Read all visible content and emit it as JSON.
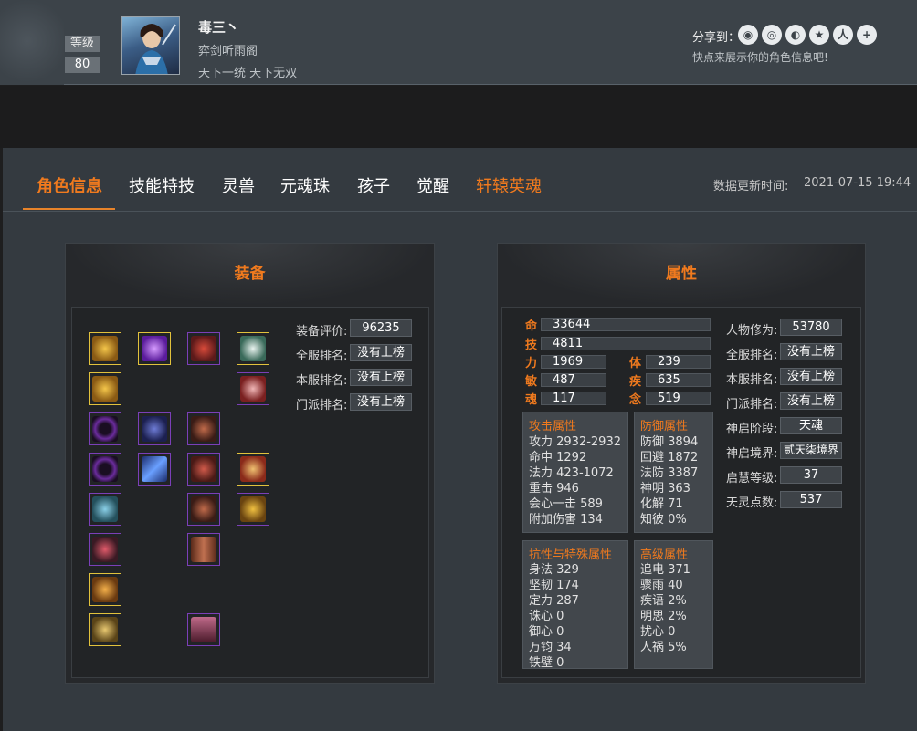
{
  "header": {
    "level_label": "等级",
    "level_value": "80",
    "player_name": "毒三丶",
    "guild": "弈剑听雨阁",
    "motto": "天下一统 天下无双",
    "share_label": "分享到：",
    "share_icons": [
      "wechat-icon",
      "qq-icon",
      "weibo-icon",
      "qzone-icon",
      "renren-icon",
      "more-plus-icon"
    ],
    "share_hint": "快点来展示你的角色信息吧!"
  },
  "tabs": [
    {
      "label": "角色信息",
      "active": true
    },
    {
      "label": "技能特技"
    },
    {
      "label": "灵兽"
    },
    {
      "label": "元魂珠"
    },
    {
      "label": "孩子"
    },
    {
      "label": "觉醒"
    },
    {
      "label": "轩辕英魂",
      "highlight": true
    }
  ],
  "update": {
    "label": "数据更新时间:",
    "time": "2021-07-15 19:44"
  },
  "colors": {
    "accent": "#f07a1e",
    "purple_border": "#7b3fb8",
    "gold_border": "#e2c23c"
  },
  "equipment": {
    "title": "装备",
    "score_label": "装备评价:",
    "score_value": "96235",
    "rank_all_label": "全服排名:",
    "rank_all_value": "没有上榜",
    "rank_server_label": "本服排名:",
    "rank_server_value": "没有上榜",
    "rank_sect_label": "门派排名:",
    "rank_sect_value": "没有上榜"
  },
  "attributes": {
    "title": "属性",
    "bars": [
      {
        "label": "命",
        "value": "33644"
      },
      {
        "label": "技",
        "value": "4811"
      }
    ],
    "pairs": [
      {
        "l1": "力",
        "v1": "1969",
        "l2": "体",
        "v2": "239"
      },
      {
        "l1": "敏",
        "v1": "487",
        "l2": "疾",
        "v2": "635"
      },
      {
        "l1": "魂",
        "v1": "117",
        "l2": "念",
        "v2": "519"
      }
    ],
    "attack": {
      "title": "攻击属性",
      "lines": [
        "攻力 2932-2932",
        "命中 1292",
        "法力 423-1072",
        "重击 946",
        "会心一击 589",
        "附加伤害 134"
      ]
    },
    "defense": {
      "title": "防御属性",
      "lines": [
        "防御 3894",
        "回避 1872",
        "法防 3387",
        "神明 363",
        "化解 71",
        "知彼 0%"
      ]
    },
    "resist": {
      "title": "抗性与特殊属性",
      "lines": [
        "身法 329",
        "坚韧 174",
        "定力 287",
        "诛心 0",
        "御心 0",
        "万钧 34",
        "铁壁 0"
      ]
    },
    "advanced": {
      "title": "高级属性",
      "lines": [
        "追电 371",
        "骤雨 40",
        "疾语 2%",
        "明思 2%",
        "扰心 0",
        "人祸 5%"
      ]
    },
    "right": [
      {
        "label": "人物修为:",
        "value": "53780"
      },
      {
        "label": "全服排名:",
        "value": "没有上榜"
      },
      {
        "label": "本服排名:",
        "value": "没有上榜"
      },
      {
        "label": "门派排名:",
        "value": "没有上榜"
      },
      {
        "label": "神启阶段:",
        "value": "天魂"
      },
      {
        "label": "神启境界:",
        "value": "贰天柒境界"
      },
      {
        "label": "启慧等级:",
        "value": "37"
      },
      {
        "label": "天灵点数:",
        "value": "537"
      }
    ]
  }
}
